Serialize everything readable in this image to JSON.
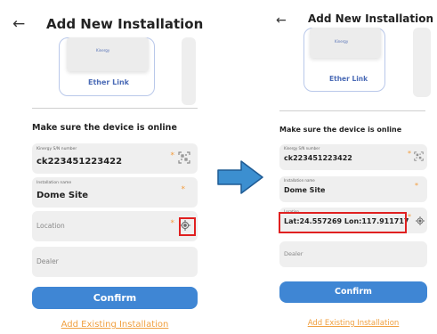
{
  "screens": [
    {
      "back_glyph": "←",
      "title": "Add New Installation",
      "device_brand": "Kinergy",
      "device_card_label": "Ether Link",
      "section_heading": "Make sure the device is online",
      "fields": {
        "serial": {
          "label": "Kinergy S/N number",
          "value": "ck223451223422"
        },
        "installation_name": {
          "label": "Installation name",
          "value": "Dome Site"
        },
        "location": {
          "label": "",
          "placeholder": "Location",
          "value": ""
        },
        "dealer": {
          "placeholder": "Dealer"
        }
      },
      "required_mark": "*",
      "confirm_label": "Confirm",
      "add_existing_label": "Add Existing Installation"
    },
    {
      "back_glyph": "←",
      "title": "Add New Installation",
      "device_brand": "Kinergy",
      "device_card_label": "Ether Link",
      "section_heading": "Make sure the device is online",
      "fields": {
        "serial": {
          "label": "Kinergy S/N number",
          "value": "ck223451223422"
        },
        "installation_name": {
          "label": "Installation name",
          "value": "Dome Site"
        },
        "location": {
          "label": "Location",
          "placeholder": "",
          "value": "Lat:24.557269 Lon:117.911717"
        },
        "dealer": {
          "placeholder": "Dealer"
        }
      },
      "required_mark": "*",
      "confirm_label": "Confirm",
      "add_existing_label": "Add Existing Installation"
    }
  ],
  "colors": {
    "primary_button": "#3f86d4",
    "link": "#f0a040",
    "required": "#f39c3c",
    "highlight": "#e02020",
    "card_border": "#b9c8ea",
    "arrow_fill": "#3c8fd0",
    "arrow_border": "#1f5b94"
  },
  "icons": {
    "back": "arrow-left-icon",
    "scan": "qr-scan-icon",
    "locate": "crosshair-locate-icon",
    "transition": "right-arrow-icon"
  }
}
